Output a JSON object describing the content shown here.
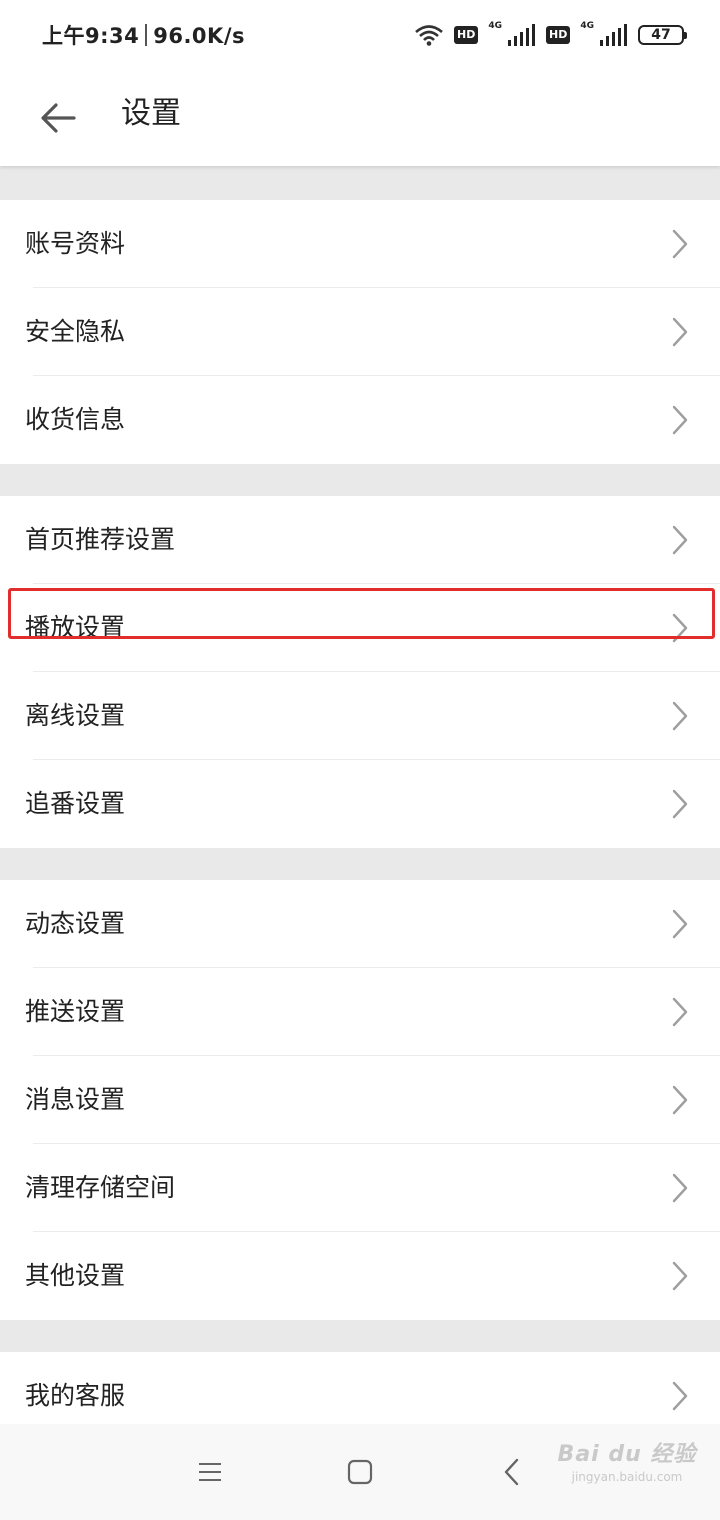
{
  "status_bar": {
    "time": "上午9:34",
    "net_speed": "96.0K/s",
    "hd_badge_1": "HD",
    "hd_badge_2": "HD",
    "network_1": "4G",
    "network_2": "4G",
    "battery": "47",
    "icons": [
      "wifi-icon",
      "signal-icon",
      "battery-icon"
    ]
  },
  "header": {
    "title": "设置",
    "back_icon": "arrow-left-icon"
  },
  "settings_groups": [
    {
      "items": [
        {
          "label": "账号资料"
        },
        {
          "label": "安全隐私"
        },
        {
          "label": "收货信息"
        }
      ]
    },
    {
      "items": [
        {
          "label": "首页推荐设置"
        },
        {
          "label": "播放设置"
        },
        {
          "label": "离线设置"
        },
        {
          "label": "追番设置"
        }
      ]
    },
    {
      "items": [
        {
          "label": "动态设置"
        },
        {
          "label": "推送设置"
        },
        {
          "label": "消息设置"
        },
        {
          "label": "清理存储空间"
        },
        {
          "label": "其他设置"
        }
      ]
    },
    {
      "items": [
        {
          "label": "我的客服"
        }
      ]
    }
  ],
  "highlighted_item": "播放设置",
  "nav_bar": {
    "icons": [
      "menu-icon",
      "home-square-icon",
      "back-chevron-icon"
    ]
  },
  "watermark": {
    "brand": "Bai du 经验",
    "url": "jingyan.baidu.com"
  },
  "colors": {
    "background": "#e9e9e9",
    "surface": "#ffffff",
    "text": "#222222",
    "chevron": "#9e9e9e",
    "highlight": "#e22d2d"
  }
}
